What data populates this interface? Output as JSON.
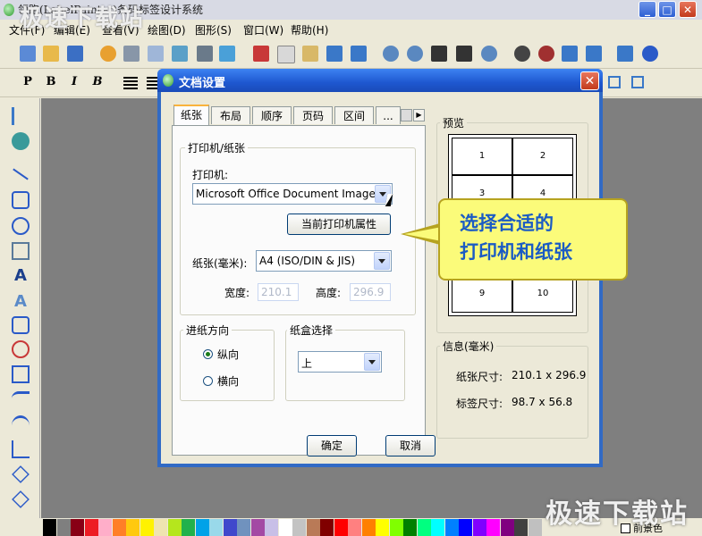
{
  "app": {
    "title": "领跑(LabelPainter)条码标签设计系统",
    "window_buttons": [
      "_",
      "□",
      "✕"
    ]
  },
  "menu": [
    "文件(F)",
    "编辑(E)",
    "查看(V)",
    "绘图(D)",
    "图形(S)",
    "窗口(W)",
    "帮助(H)"
  ],
  "format_toolbar": [
    "P",
    "B",
    "I",
    "B"
  ],
  "watermark": {
    "top": "极速下载站",
    "bottom": "极速下载站"
  },
  "dialog": {
    "title": "文档设置",
    "close_label": "✕",
    "tabs": [
      "纸张",
      "布局",
      "顺序",
      "页码",
      "区间",
      "..."
    ],
    "active_tab": "纸张",
    "printer_group": "打印机/纸张",
    "printer_label": "打印机:",
    "printer_value": "Microsoft Office Document Image ...",
    "printer_props_button": "当前打印机属性",
    "paper_label": "纸张(毫米):",
    "paper_value": "A4 (ISO/DIN & JIS)",
    "width_label": "宽度:",
    "width_value": "210.1",
    "height_label": "高度:",
    "height_value": "296.9",
    "orientation_group": "进纸方向",
    "orientation_options": [
      "纵向",
      "横向"
    ],
    "orientation_selected": "纵向",
    "tray_group": "纸盒选择",
    "tray_value": "上",
    "preview_group": "预览",
    "preview_cells": [
      "1",
      "2",
      "3",
      "4",
      "9",
      "10"
    ],
    "info_group": "信息(毫米)",
    "paper_size_label": "纸张尺寸:",
    "paper_size_value": "210.1 x 296.9",
    "label_size_label": "标签尺寸:",
    "label_size_value": "98.7 x 56.8",
    "ok_button": "确定",
    "cancel_button": "取消"
  },
  "callout": {
    "line1": "选择合适的",
    "line2": "打印机和纸张"
  },
  "palette_label": "前景色",
  "palette_colors": [
    "#000000",
    "#7f7f7f",
    "#880015",
    "#ed1c24",
    "#ffaec9",
    "#ff7f27",
    "#ffc90e",
    "#fff200",
    "#efe4b0",
    "#b5e61d",
    "#22b14c",
    "#00a2e8",
    "#99d9ea",
    "#3f48cc",
    "#7092be",
    "#a349a4",
    "#c8bfe7",
    "#ffffff",
    "#c3c3c3",
    "#b97a57",
    "#800000",
    "#ff0000",
    "#ff8080",
    "#ff8000",
    "#ffff00",
    "#80ff00",
    "#008000",
    "#00ff80",
    "#00ffff",
    "#0080ff",
    "#0000ff",
    "#8000ff",
    "#ff00ff",
    "#800080",
    "#404040",
    "#c0c0c0"
  ]
}
